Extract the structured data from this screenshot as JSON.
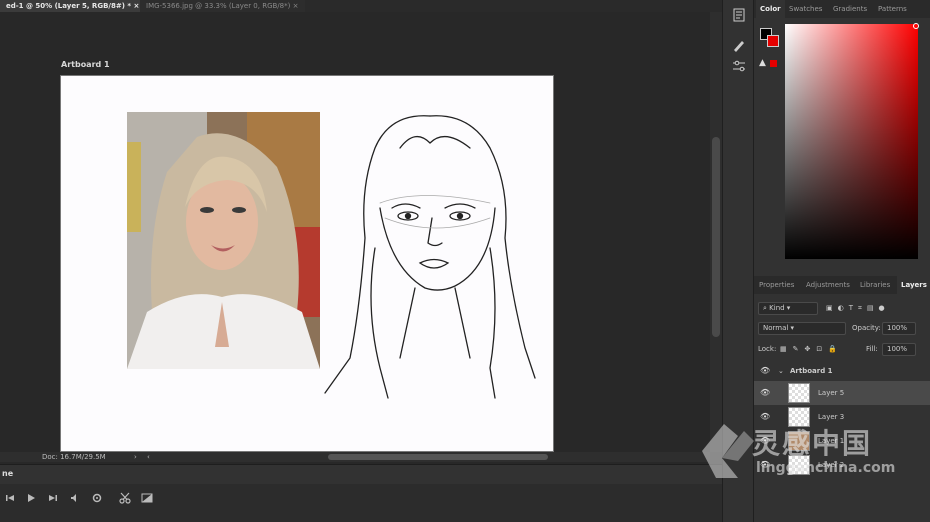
{
  "tabs": {
    "active": "ed-1 @ 50% (Layer 5, RGB/8#) *",
    "inactive": "IMG-5366.jpg @ 33.3% (Layer 0, RGB/8*)",
    "close_glyph": "×"
  },
  "canvas": {
    "artboard_label": "Artboard 1"
  },
  "status": {
    "doc": "Doc: 16.7M/29.5M",
    "arrow": "›",
    "arrow2": "‹"
  },
  "timeline": {
    "tab_label": "ne"
  },
  "color_panel": {
    "tabs": [
      "Color",
      "Swatches",
      "Gradients",
      "Patterns"
    ],
    "warn_glyph": "▲",
    "foreground": "#000000",
    "background": "#e50000"
  },
  "layers_panel": {
    "tabs": [
      "Properties",
      "Adjustments",
      "Libraries",
      "Layers"
    ],
    "kind_label": "Kind",
    "blend_mode": "Normal",
    "opacity_label": "Opacity:",
    "opacity_value": "100%",
    "lock_label": "Lock:",
    "fill_label": "Fill:",
    "fill_value": "100%",
    "artboard_group": "Artboard 1",
    "layers": [
      "Layer 5",
      "Layer 3",
      "Layer 1",
      "Layer 2"
    ]
  },
  "watermark": {
    "brand_cn": "灵感中国",
    "brand_url": "lingganchina.com"
  }
}
